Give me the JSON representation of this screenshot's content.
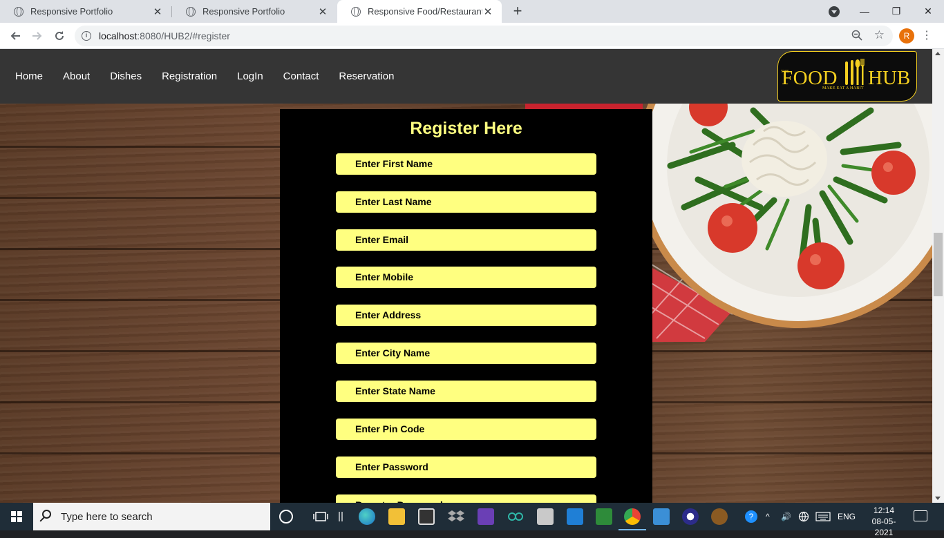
{
  "browser": {
    "tabs": [
      {
        "title": "Responsive Portfolio",
        "active": false
      },
      {
        "title": "Responsive Portfolio",
        "active": false
      },
      {
        "title": "Responsive Food/Restaurant Wel",
        "active": true
      }
    ],
    "new_tab": "+",
    "url_host": "localhost",
    "url_rest": ":8080/HUB2/#register",
    "profile_initial": "R",
    "window_controls": {
      "minimize": "—",
      "restore": "❐",
      "close": "✕"
    }
  },
  "site": {
    "nav": [
      "Home",
      "About",
      "Dishes",
      "Registration",
      "LogIn",
      "Contact",
      "Reservation"
    ],
    "logo": {
      "the": "THE",
      "left": "FOOD",
      "right": "HUB",
      "tagline": "MAKE EAT A HABIT"
    },
    "register": {
      "heading": "Register Here",
      "placeholders": [
        "Enter First Name",
        "Enter Last Name",
        "Enter Email",
        "Enter Mobile",
        "Enter Address",
        "Enter City Name",
        "Enter State Name",
        "Enter Pin Code",
        "Enter Password",
        "Re-enter Password"
      ]
    }
  },
  "taskbar": {
    "search_placeholder": "Type here to search",
    "language": "ENG",
    "time": "12:14",
    "date": "08-05-2021"
  }
}
